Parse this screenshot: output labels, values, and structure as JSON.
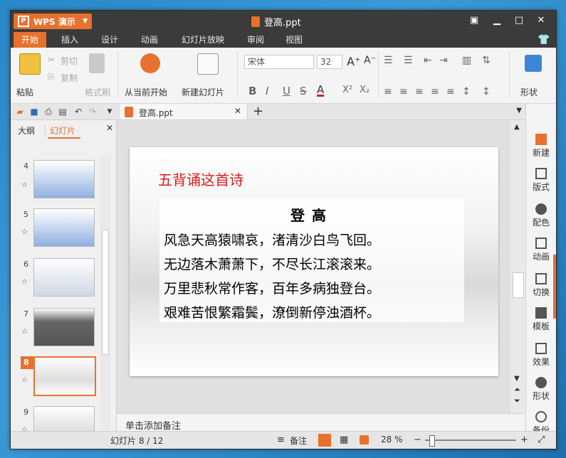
{
  "app": {
    "name": "WPS 演示",
    "doc_title": "登高.ppt"
  },
  "menu": {
    "tabs": [
      "开始",
      "插入",
      "设计",
      "动画",
      "幻灯片放映",
      "审阅",
      "视图"
    ],
    "active": "开始"
  },
  "ribbon": {
    "paste": "粘贴",
    "cut": "剪切",
    "copy": "复制",
    "format_painter": "格式刷",
    "from_current": "从当前开始",
    "new_slide": "新建幻灯片",
    "font_name": "宋体",
    "font_size": "32",
    "shape": "形状"
  },
  "doc_tab": {
    "label": "登高.ppt"
  },
  "left_panel": {
    "tabs": [
      "大纲",
      "幻灯片"
    ],
    "active": "幻灯片",
    "thumbs": [
      {
        "num": "4"
      },
      {
        "num": "5"
      },
      {
        "num": "6"
      },
      {
        "num": "7"
      },
      {
        "num": "8"
      },
      {
        "num": "9"
      }
    ],
    "selected": "8"
  },
  "slide": {
    "heading": "五背诵这首诗",
    "poem_title": "登高",
    "lines": [
      "风急天高猿啸哀，渚清沙白鸟飞回。",
      "无边落木萧萧下，不尽长江滚滚来。",
      "万里悲秋常作客，百年多病独登台。",
      "艰难苦恨繁霜鬓，潦倒新停浊酒杯。"
    ]
  },
  "notes": {
    "placeholder": "单击添加备注"
  },
  "right_panel": {
    "items": [
      "新建",
      "版式",
      "配色",
      "动画",
      "切换",
      "模板",
      "效果",
      "形状",
      "备份"
    ]
  },
  "status": {
    "slide_counter": "幻灯片 8 / 12",
    "notes_btn": "备注",
    "zoom": "28 %",
    "zoom_value_percent": 28
  },
  "colors": {
    "accent": "#e8712e",
    "heading_red": "#e21b1b",
    "title_bar": "#3b3b3b"
  }
}
